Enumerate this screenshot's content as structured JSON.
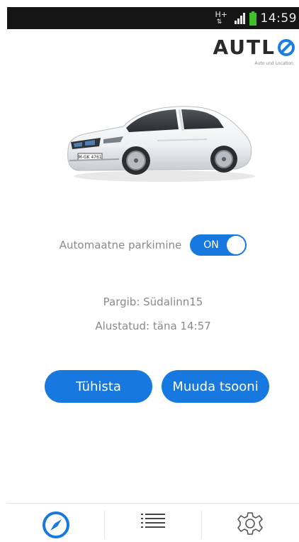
{
  "status_bar": {
    "network_type": "H+",
    "time": "14:59",
    "icons": [
      "network-type-icon",
      "signal-icon",
      "battery-icon"
    ],
    "battery_color": "#3fbf2a"
  },
  "logo": {
    "word_dark": "AUTL",
    "tagline": "Auto und Location",
    "accent_color": "#1e7de0"
  },
  "car": {
    "plate": "M-GK 4761",
    "color": "white"
  },
  "parking": {
    "toggle_label": "Automaatne parkimine",
    "toggle_state": "ON",
    "zone_text": "Pargib: Südalinn15",
    "started_text": "Alustatud: täna 14:57"
  },
  "buttons": {
    "cancel_label": "Tühista",
    "change_zone_label": "Muuda tsooni"
  },
  "tabs": [
    {
      "icon": "compass-icon",
      "active": true
    },
    {
      "icon": "list-icon",
      "active": false
    },
    {
      "icon": "settings-gear-icon",
      "active": false
    }
  ],
  "colors": {
    "accent": "#1778e0",
    "text_muted": "#8a8a8a",
    "status_bar": "#151515"
  }
}
